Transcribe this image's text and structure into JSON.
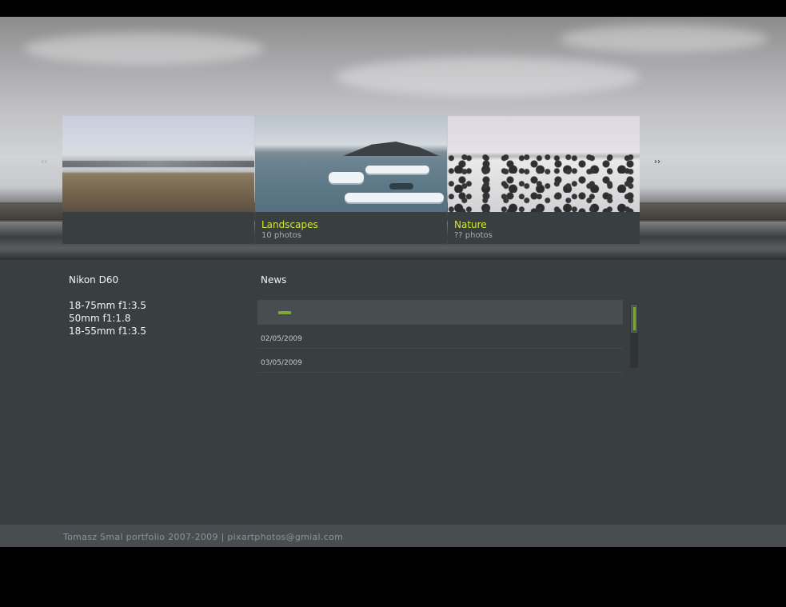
{
  "gallery": {
    "prev_label": "‹‹",
    "next_label": "››",
    "albums": [
      {
        "title": "",
        "count": ""
      },
      {
        "title": "Landscapes",
        "count": "10 photos"
      },
      {
        "title": "Nature",
        "count": "?? photos"
      }
    ]
  },
  "equipment": {
    "camera": "Nikon D60",
    "lenses": [
      "18-75mm f1:3.5",
      "50mm f1:1.8",
      "18-55mm f1:3.5"
    ]
  },
  "news": {
    "title": "News",
    "items": [
      {
        "date": "02/05/2009"
      },
      {
        "date": "03/05/2009"
      }
    ]
  },
  "footer": {
    "text": "Tomasz Smal portfolio 2007-2009 | pixartphotos@gmial.com"
  },
  "colors": {
    "accent_yellow": "#d9e43b",
    "accent_green": "#7ea53a",
    "panel": "#393e40",
    "footer": "#484d50"
  }
}
